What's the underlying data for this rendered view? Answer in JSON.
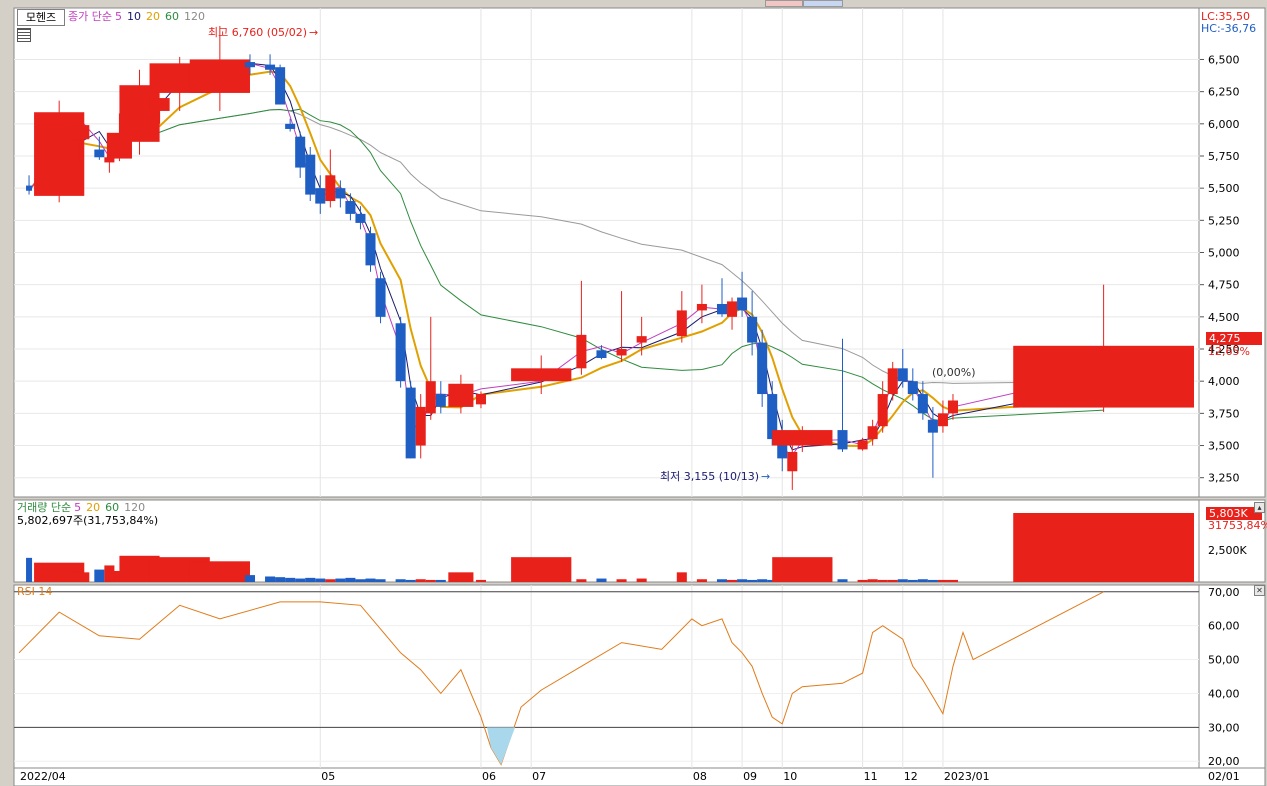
{
  "stock_tab": "모헨즈",
  "price_legend": {
    "label": "종가 단순",
    "p5": "5",
    "p10": "10",
    "p20": "20",
    "p60": "60",
    "p120": "120"
  },
  "volume_legend": {
    "label": "거래량 단순",
    "p5": "5",
    "p20": "20",
    "p60": "60",
    "p120": "120",
    "current": "5,802,697주(31,753,84%)"
  },
  "rsi_legend": {
    "label": "RSI 14"
  },
  "right_info": {
    "lc": "LC:35,50",
    "hc": "HC:-36,76"
  },
  "current_price_badge": "4,275",
  "current_change": "12,65%",
  "volume_badge": "5,803K",
  "volume_pct": "31753,84%",
  "annotations": {
    "high": "최고 6,760 (05/02)",
    "low": "최저 3,155 (10/13)",
    "mid": "(0,00%)"
  },
  "colors": {
    "up": "#e8211b",
    "down": "#1f5fc4",
    "ma5": "#c03fc0",
    "ma10": "#1a1a6e",
    "ma20": "#e0a000",
    "ma60": "#2e8b3e",
    "ma120": "#9a9a9a",
    "rsi": "#e07b1a"
  },
  "chart_data": {
    "type": "candlestick",
    "price_axis": {
      "ticks": [
        "6,500",
        "6,250",
        "6,000",
        "5,750",
        "5,500",
        "5,250",
        "5,000",
        "4,750",
        "4,500",
        "4,250",
        "4,000",
        "3,750",
        "3,500",
        "3,250"
      ],
      "ylim": [
        3100,
        6900
      ]
    },
    "volume_axis": {
      "ticks": [
        "2,500K"
      ]
    },
    "rsi_axis": {
      "ticks": [
        "70,00",
        "60,00",
        "50,00",
        "40,00",
        "30,00",
        "20,00"
      ],
      "ylim": [
        18,
        72
      ],
      "levels": [
        70,
        30
      ]
    },
    "x_ticks": [
      "2022/04",
      "05",
      "06",
      "07",
      "08",
      "09",
      "10",
      "11",
      "12",
      "2023/01",
      "02/01"
    ],
    "x_tick_index": [
      0,
      30,
      46,
      51,
      67,
      72,
      76,
      84,
      88,
      92,
      116
    ],
    "candles": [
      {
        "o": 5520,
        "h": 5600,
        "l": 5450,
        "c": 5480
      },
      {
        "o": 5440,
        "h": 6180,
        "l": 5390,
        "c": 6090
      },
      {
        "o": 5880,
        "h": 6000,
        "l": 5680,
        "c": 5990
      },
      {
        "o": 5800,
        "h": 5900,
        "l": 5720,
        "c": 5740
      },
      {
        "o": 5700,
        "h": 5820,
        "l": 5620,
        "c": 5740
      },
      {
        "o": 5730,
        "h": 6080,
        "l": 5710,
        "c": 5930
      },
      {
        "o": 5860,
        "h": 6420,
        "l": 5760,
        "c": 6300
      },
      {
        "o": 6100,
        "h": 6200,
        "l": 6000,
        "c": 6200
      },
      {
        "o": 6240,
        "h": 6520,
        "l": 6100,
        "c": 6470
      },
      {
        "o": 6240,
        "h": 6760,
        "l": 6100,
        "c": 6500
      },
      {
        "o": 6480,
        "h": 6540,
        "l": 6380,
        "c": 6440
      },
      {
        "o": 6460,
        "h": 6540,
        "l": 6380,
        "c": 6420
      },
      {
        "o": 6440,
        "h": 6460,
        "l": 6150,
        "c": 6150
      },
      {
        "o": 6000,
        "h": 6040,
        "l": 5940,
        "c": 5960
      },
      {
        "o": 5900,
        "h": 5940,
        "l": 5580,
        "c": 5660
      },
      {
        "o": 5760,
        "h": 5820,
        "l": 5400,
        "c": 5450
      },
      {
        "o": 5500,
        "h": 5600,
        "l": 5300,
        "c": 5380
      },
      {
        "o": 5400,
        "h": 5800,
        "l": 5350,
        "c": 5600
      },
      {
        "o": 5500,
        "h": 5560,
        "l": 5350,
        "c": 5420
      },
      {
        "o": 5400,
        "h": 5460,
        "l": 5250,
        "c": 5300
      },
      {
        "o": 5300,
        "h": 5360,
        "l": 5180,
        "c": 5230
      },
      {
        "o": 5150,
        "h": 5200,
        "l": 4850,
        "c": 4900
      },
      {
        "o": 4800,
        "h": 4850,
        "l": 4450,
        "c": 4500
      },
      {
        "o": 4450,
        "h": 4500,
        "l": 3950,
        "c": 4000
      },
      {
        "o": 3950,
        "h": 4000,
        "l": 3400,
        "c": 3400
      },
      {
        "o": 3500,
        "h": 3900,
        "l": 3400,
        "c": 3800
      },
      {
        "o": 3750,
        "h": 4500,
        "l": 3700,
        "c": 4000
      },
      {
        "o": 3900,
        "h": 4000,
        "l": 3750,
        "c": 3800
      },
      {
        "o": 3800,
        "h": 4050,
        "l": 3750,
        "c": 3980
      },
      {
        "o": 3820,
        "h": 3920,
        "l": 3790,
        "c": 3900
      },
      {
        "o": 4000,
        "h": 4200,
        "l": 3900,
        "c": 4100
      },
      {
        "o": 4100,
        "h": 4780,
        "l": 4050,
        "c": 4360
      },
      {
        "o": 4240,
        "h": 4280,
        "l": 4170,
        "c": 4180
      },
      {
        "o": 4200,
        "h": 4700,
        "l": 4150,
        "c": 4250
      },
      {
        "o": 4300,
        "h": 4500,
        "l": 4200,
        "c": 4350
      },
      {
        "o": 4350,
        "h": 4700,
        "l": 4300,
        "c": 4550
      },
      {
        "o": 4550,
        "h": 4750,
        "l": 4450,
        "c": 4600
      },
      {
        "o": 4600,
        "h": 4800,
        "l": 4500,
        "c": 4520
      },
      {
        "o": 4500,
        "h": 4650,
        "l": 4400,
        "c": 4620
      },
      {
        "o": 4650,
        "h": 4850,
        "l": 4500,
        "c": 4550
      },
      {
        "o": 4500,
        "h": 4700,
        "l": 4200,
        "c": 4300
      },
      {
        "o": 4300,
        "h": 4400,
        "l": 3800,
        "c": 3900
      },
      {
        "o": 3900,
        "h": 4000,
        "l": 3500,
        "c": 3550
      },
      {
        "o": 3600,
        "h": 3700,
        "l": 3300,
        "c": 3400
      },
      {
        "o": 3300,
        "h": 3500,
        "l": 3155,
        "c": 3450
      },
      {
        "o": 3500,
        "h": 3650,
        "l": 3450,
        "c": 3620
      },
      {
        "o": 3620,
        "h": 4330,
        "l": 3450,
        "c": 3470
      },
      {
        "o": 3470,
        "h": 3560,
        "l": 3460,
        "c": 3540
      },
      {
        "o": 3550,
        "h": 3700,
        "l": 3500,
        "c": 3650
      },
      {
        "o": 3650,
        "h": 4000,
        "l": 3600,
        "c": 3900
      },
      {
        "o": 3900,
        "h": 4150,
        "l": 3850,
        "c": 4100
      },
      {
        "o": 4100,
        "h": 4250,
        "l": 3950,
        "c": 4000
      },
      {
        "o": 4000,
        "h": 4100,
        "l": 3850,
        "c": 3900
      },
      {
        "o": 3900,
        "h": 4000,
        "l": 3700,
        "c": 3750
      },
      {
        "o": 3700,
        "h": 3800,
        "l": 3250,
        "c": 3600
      },
      {
        "o": 3650,
        "h": 3850,
        "l": 3600,
        "c": 3750
      },
      {
        "o": 3750,
        "h": 3900,
        "l": 3700,
        "c": 3850
      },
      {
        "o": 3795,
        "h": 4750,
        "l": 3760,
        "c": 4275
      }
    ],
    "candle_x": [
      1,
      4,
      6,
      8,
      9,
      10,
      12,
      14,
      16,
      20,
      23,
      25,
      26,
      27,
      28,
      29,
      30,
      31,
      32,
      33,
      34,
      35,
      36,
      38,
      39,
      40,
      41,
      42,
      44,
      46,
      52,
      56,
      58,
      60,
      62,
      66,
      68,
      70,
      71,
      72,
      73,
      74,
      75,
      76,
      77,
      78,
      82,
      84,
      85,
      86,
      87,
      88,
      89,
      90,
      91,
      92,
      93,
      108
    ],
    "candle_w": [
      0.6,
      5,
      2,
      1,
      1,
      2.5,
      4,
      2,
      6,
      6,
      1,
      1,
      1,
      1,
      1,
      1,
      1,
      1,
      1,
      1,
      1,
      1,
      1,
      1,
      1,
      1,
      1,
      1,
      2.5,
      1,
      6,
      1,
      1,
      1,
      1,
      1,
      1,
      1,
      1,
      1,
      1,
      1,
      1,
      1,
      1,
      6,
      1,
      1,
      1,
      1,
      1,
      1,
      1,
      1,
      1,
      1,
      1,
      18
    ],
    "volume": [
      0.35,
      0.28,
      0.14,
      0.18,
      0.24,
      0.16,
      0.38,
      0.12,
      0.36,
      0.3,
      0.1,
      0.08,
      0.07,
      0.06,
      0.05,
      0.06,
      0.05,
      0.04,
      0.05,
      0.06,
      0.04,
      0.05,
      0.04,
      0.04,
      0.03,
      0.04,
      0.03,
      0.03,
      0.14,
      0.03,
      0.36,
      0.04,
      0.05,
      0.04,
      0.05,
      0.14,
      0.04,
      0.04,
      0.03,
      0.04,
      0.03,
      0.04,
      0.03,
      0.04,
      0.03,
      0.36,
      0.04,
      0.03,
      0.04,
      0.03,
      0.03,
      0.04,
      0.03,
      0.04,
      0.03,
      0.03,
      0.03,
      1.0
    ],
    "rsi": [
      [
        0,
        52
      ],
      [
        4,
        64
      ],
      [
        8,
        57
      ],
      [
        12,
        56
      ],
      [
        16,
        66
      ],
      [
        20,
        62
      ],
      [
        26,
        67
      ],
      [
        30,
        67
      ],
      [
        34,
        66
      ],
      [
        38,
        52
      ],
      [
        40,
        47
      ],
      [
        42,
        40
      ],
      [
        44,
        47
      ],
      [
        46,
        33
      ],
      [
        47,
        24
      ],
      [
        48,
        19
      ],
      [
        50,
        36
      ],
      [
        52,
        41
      ],
      [
        56,
        48
      ],
      [
        60,
        55
      ],
      [
        64,
        53
      ],
      [
        67,
        62
      ],
      [
        68,
        60
      ],
      [
        70,
        62
      ],
      [
        71,
        55
      ],
      [
        72,
        52
      ],
      [
        73,
        48
      ],
      [
        74,
        40
      ],
      [
        75,
        33
      ],
      [
        76,
        31
      ],
      [
        77,
        40
      ],
      [
        78,
        42
      ],
      [
        82,
        43
      ],
      [
        84,
        46
      ],
      [
        85,
        58
      ],
      [
        86,
        60
      ],
      [
        87,
        58
      ],
      [
        88,
        56
      ],
      [
        89,
        48
      ],
      [
        90,
        44
      ],
      [
        91,
        39
      ],
      [
        92,
        34
      ],
      [
        93,
        48
      ],
      [
        94,
        58
      ],
      [
        95,
        50
      ],
      [
        108,
        70
      ]
    ]
  }
}
